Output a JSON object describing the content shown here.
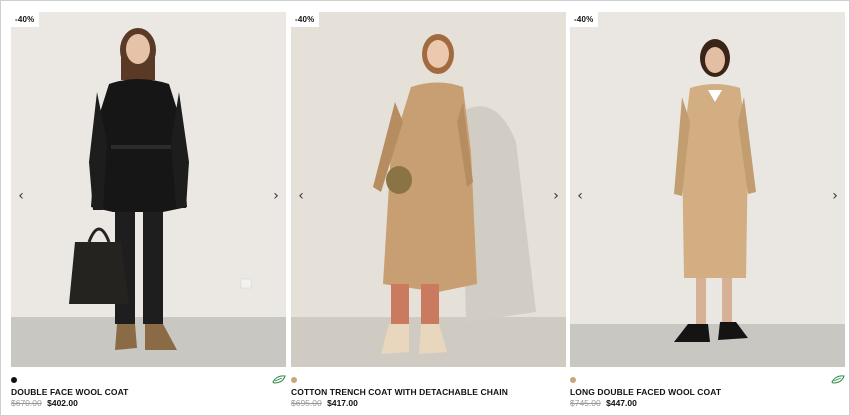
{
  "products": [
    {
      "badge": "-40%",
      "name": "DOUBLE FACE WOOL COAT",
      "old_price": "$670.00",
      "price": "$402.00",
      "swatch_color": "#111111",
      "eco": true,
      "prev_icon": "chevron-left-icon",
      "next_icon": "chevron-right-icon"
    },
    {
      "badge": "-40%",
      "name": "COTTON TRENCH COAT WITH DETACHABLE CHAIN",
      "old_price": "$695.00",
      "price": "$417.00",
      "swatch_color": "#c9a77c",
      "eco": false,
      "prev_icon": "chevron-left-icon",
      "next_icon": "chevron-right-icon"
    },
    {
      "badge": "-40%",
      "name": "LONG DOUBLE FACED WOOL COAT",
      "old_price": "$745.00",
      "price": "$447.00",
      "swatch_color": "#c9a77c",
      "eco": true,
      "prev_icon": "chevron-left-icon",
      "next_icon": "chevron-right-icon"
    }
  ],
  "arrows": {
    "prev": "‹",
    "next": "›"
  },
  "colors": {
    "wall": "#ebe8e4",
    "floor": "#c9c7c2",
    "camel": "#c79f72",
    "black": "#161616"
  }
}
